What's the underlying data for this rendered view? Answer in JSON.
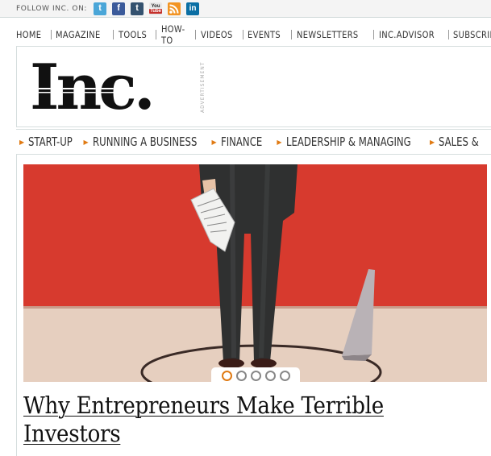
{
  "follow_bar": {
    "label": "FOLLOW INC. ON:",
    "icons": [
      {
        "name": "twitter-icon",
        "glyph": "t"
      },
      {
        "name": "facebook-icon",
        "glyph": "f"
      },
      {
        "name": "tumblr-icon",
        "glyph": "t"
      },
      {
        "name": "youtube-icon",
        "glyph_top": "You",
        "glyph_bottom": "Tube"
      },
      {
        "name": "rss-icon",
        "glyph": ""
      },
      {
        "name": "linkedin-icon",
        "glyph": "in"
      }
    ]
  },
  "top_nav": {
    "items": [
      "HOME",
      "MAGAZINE",
      "TOOLS",
      "HOW-TO",
      "VIDEOS",
      "EVENTS",
      "NEWSLETTERS",
      "INC.ADVISOR",
      "SUBSCRIBE"
    ]
  },
  "header": {
    "logo_text": "Inc.",
    "ad_label": "ADVERTISEMENT"
  },
  "category_nav": {
    "items": [
      "START-UP",
      "RUNNING A BUSINESS",
      "FINANCE",
      "LEADERSHIP & MANAGING",
      "SALES &"
    ]
  },
  "hero": {
    "slide_count": 5,
    "active_slide": 1
  },
  "article": {
    "headline": "Why Entrepreneurs Make Terrible Investors"
  },
  "colors": {
    "accent_orange": "#e07a13",
    "hero_red": "#d73a2e",
    "floor_beige": "#e6cfbf",
    "nav_text": "#333333"
  }
}
